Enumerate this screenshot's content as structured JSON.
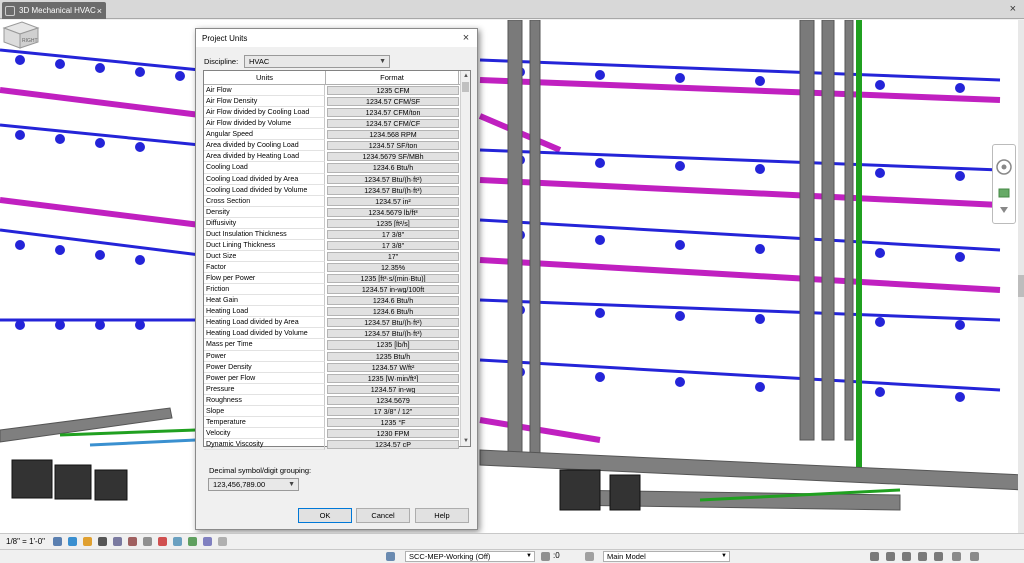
{
  "tab": {
    "title": "3D Mechanical HVAC",
    "close_glyph": "×"
  },
  "window": {
    "close_glyph": "×"
  },
  "viewcube": {
    "label": "RIGHT"
  },
  "dialog": {
    "title": "Project Units",
    "close_glyph": "×",
    "discipline_label": "Discipline:",
    "discipline_value": "HVAC",
    "columns": [
      "Units",
      "Format"
    ],
    "rows": [
      {
        "unit": "Air Flow",
        "format": "1235 CFM"
      },
      {
        "unit": "Air Flow Density",
        "format": "1234.57 CFM/SF"
      },
      {
        "unit": "Air Flow divided by Cooling Load",
        "format": "1234.57 CFM/ton"
      },
      {
        "unit": "Air Flow divided by Volume",
        "format": "1234.57 CFM/CF"
      },
      {
        "unit": "Angular Speed",
        "format": "1234.568 RPM"
      },
      {
        "unit": "Area divided by Cooling Load",
        "format": "1234.57 SF/ton"
      },
      {
        "unit": "Area divided by Heating Load",
        "format": "1234.5679 SF/MBh"
      },
      {
        "unit": "Cooling Load",
        "format": "1234.6 Btu/h"
      },
      {
        "unit": "Cooling Load divided by Area",
        "format": "1234.57 Btu/(h·ft²)"
      },
      {
        "unit": "Cooling Load divided by Volume",
        "format": "1234.57 Btu/(h·ft³)"
      },
      {
        "unit": "Cross Section",
        "format": "1234.57 in²"
      },
      {
        "unit": "Density",
        "format": "1234.5679 lb/ft³"
      },
      {
        "unit": "Diffusivity",
        "format": "1235 [ft²/s]"
      },
      {
        "unit": "Duct Insulation Thickness",
        "format": "17 3/8\""
      },
      {
        "unit": "Duct Lining Thickness",
        "format": "17 3/8\""
      },
      {
        "unit": "Duct Size",
        "format": "17\""
      },
      {
        "unit": "Factor",
        "format": "12.35%"
      },
      {
        "unit": "Flow per Power",
        "format": "1235 [ft³·s/(min·Btu)]"
      },
      {
        "unit": "Friction",
        "format": "1234.57 in-wg/100ft"
      },
      {
        "unit": "Heat Gain",
        "format": "1234.6 Btu/h"
      },
      {
        "unit": "Heating Load",
        "format": "1234.6 Btu/h"
      },
      {
        "unit": "Heating Load divided by Area",
        "format": "1234.57 Btu/(h·ft²)"
      },
      {
        "unit": "Heating Load divided by Volume",
        "format": "1234.57 Btu/(h·ft³)"
      },
      {
        "unit": "Mass per Time",
        "format": "1235 [lb/h]"
      },
      {
        "unit": "Power",
        "format": "1235 Btu/h"
      },
      {
        "unit": "Power Density",
        "format": "1234.57 W/ft²"
      },
      {
        "unit": "Power per Flow",
        "format": "1235 [W·min/ft³]"
      },
      {
        "unit": "Pressure",
        "format": "1234.57 in-wg"
      },
      {
        "unit": "Roughness",
        "format": "1234.5679"
      },
      {
        "unit": "Slope",
        "format": "17 3/8\" / 12\""
      },
      {
        "unit": "Temperature",
        "format": "1235 °F"
      },
      {
        "unit": "Velocity",
        "format": "1230 FPM"
      },
      {
        "unit": "Dynamic Viscosity",
        "format": "1234.57 cP"
      }
    ],
    "decimal_label": "Decimal symbol/digit grouping:",
    "decimal_value": "123,456,789.00",
    "ok_label": "OK",
    "cancel_label": "Cancel",
    "help_label": "Help"
  },
  "viewbar": {
    "scale": "1/8\" = 1'-0\""
  },
  "statusbar": {
    "workset": "SCC-MEP-Working (Off)",
    "count": ":0",
    "model": "Main Model"
  },
  "colors": {
    "duct_magenta": "#c020c0",
    "duct_blue": "#2020d0",
    "pipe_gray": "#707070",
    "pipe_green": "#20a020"
  }
}
